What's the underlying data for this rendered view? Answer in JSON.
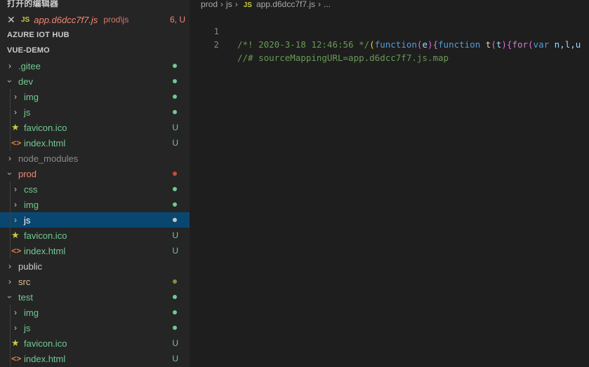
{
  "colors": {
    "sidebar_bg": "#252526",
    "editor_bg": "#1e1e1e",
    "selection": "#094771",
    "untracked": "#73c991",
    "modified": "#e2c08d",
    "error": "#f48771",
    "dot_green": "#73c991",
    "dot_red": "#c74e39",
    "dot_olive": "#8a8a4a"
  },
  "open_editors": {
    "title": "打开的编辑器",
    "file": {
      "name": "app.d6dcc7f7.js",
      "path": "prod\\js",
      "status": "6, U",
      "badge": "JS"
    }
  },
  "sections": {
    "azure": "AZURE IOT HUB",
    "vue_demo": "VUE-DEMO"
  },
  "tree": [
    {
      "label": ".gitee",
      "kind": "folder",
      "open": false,
      "depth": 0,
      "dot": "green"
    },
    {
      "label": "dev",
      "kind": "folder",
      "open": true,
      "depth": 0,
      "dot": "green"
    },
    {
      "label": "img",
      "kind": "folder",
      "open": false,
      "depth": 1,
      "dot": "green"
    },
    {
      "label": "js",
      "kind": "folder",
      "open": false,
      "depth": 1,
      "dot": "green"
    },
    {
      "label": "favicon.ico",
      "kind": "ico",
      "depth": 1,
      "status": "U"
    },
    {
      "label": "index.html",
      "kind": "html",
      "depth": 1,
      "status": "U"
    },
    {
      "label": "node_modules",
      "kind": "folder",
      "open": false,
      "depth": 0,
      "dim": true
    },
    {
      "label": "prod",
      "kind": "folder",
      "open": true,
      "depth": 0,
      "dot": "red",
      "error": true
    },
    {
      "label": "css",
      "kind": "folder",
      "open": false,
      "depth": 1,
      "dot": "green"
    },
    {
      "label": "img",
      "kind": "folder",
      "open": false,
      "depth": 1,
      "dot": "green"
    },
    {
      "label": "js",
      "kind": "folder",
      "open": false,
      "depth": 1,
      "dot": "white",
      "selected": true
    },
    {
      "label": "favicon.ico",
      "kind": "ico",
      "depth": 1,
      "status": "U"
    },
    {
      "label": "index.html",
      "kind": "html",
      "depth": 1,
      "status": "U"
    },
    {
      "label": "public",
      "kind": "folder",
      "open": false,
      "depth": 0,
      "plain": true
    },
    {
      "label": "src",
      "kind": "folder",
      "open": false,
      "depth": 0,
      "dot": "olive",
      "modified": true
    },
    {
      "label": "test",
      "kind": "folder",
      "open": true,
      "depth": 0,
      "dot": "green"
    },
    {
      "label": "img",
      "kind": "folder",
      "open": false,
      "depth": 1,
      "dot": "green"
    },
    {
      "label": "js",
      "kind": "folder",
      "open": false,
      "depth": 1,
      "dot": "green"
    },
    {
      "label": "favicon.ico",
      "kind": "ico",
      "depth": 1,
      "status": "U"
    },
    {
      "label": "index.html",
      "kind": "html",
      "depth": 1,
      "status": "U"
    }
  ],
  "breadcrumb": {
    "parts": [
      "prod",
      "js"
    ],
    "badge": "JS",
    "file": "app.d6dcc7f7.js",
    "more": "..."
  },
  "code": {
    "line1_no": "1",
    "line2_no": "2",
    "l1_comment": "/*! 2020-3-18 12:46:56 */",
    "l1_p1": "(",
    "l1_kw1": "function",
    "l1_p2": "(",
    "l1_param": "e",
    "l1_p3": "){",
    "l1_kw2": "function",
    "l1_fn": " t",
    "l1_p4": "(",
    "l1_param2": "t",
    "l1_p5": "){",
    "l1_for": "for",
    "l1_p6": "(",
    "l1_var": "var",
    "l1_rest": " n,l,u",
    "l2_comment": "//# sourceMappingURL=app.d6dcc7f7.js.map"
  }
}
